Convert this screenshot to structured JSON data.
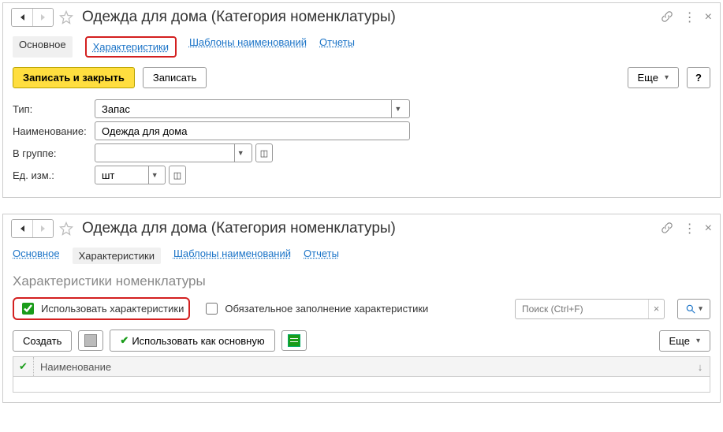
{
  "window1": {
    "title": "Одежда для дома (Категория номенклатуры)",
    "tabs": {
      "main": "Основное",
      "chars": "Характеристики",
      "templates": "Шаблоны наименований",
      "reports": "Отчеты"
    },
    "cmd": {
      "save_close": "Записать и закрыть",
      "save": "Записать",
      "more": "Еще",
      "help": "?"
    },
    "form": {
      "type_label": "Тип:",
      "type_value": "Запас",
      "name_label": "Наименование:",
      "name_value": "Одежда для дома",
      "group_label": "В группе:",
      "group_value": "",
      "uom_label": "Ед. изм.:",
      "uom_value": "шт"
    }
  },
  "window2": {
    "title": "Одежда для дома (Категория номенклатуры)",
    "tabs": {
      "main": "Основное",
      "chars": "Характеристики",
      "templates": "Шаблоны наименований",
      "reports": "Отчеты"
    },
    "section_title": "Характеристики номенклатуры",
    "checks": {
      "use_chars": "Использовать характеристики",
      "mandatory": "Обязательное заполнение характеристики"
    },
    "search_placeholder": "Поиск (Ctrl+F)",
    "listbar": {
      "create": "Создать",
      "use_as_main": "Использовать как основную",
      "more": "Еще"
    },
    "table": {
      "col_name": "Наименование"
    }
  }
}
